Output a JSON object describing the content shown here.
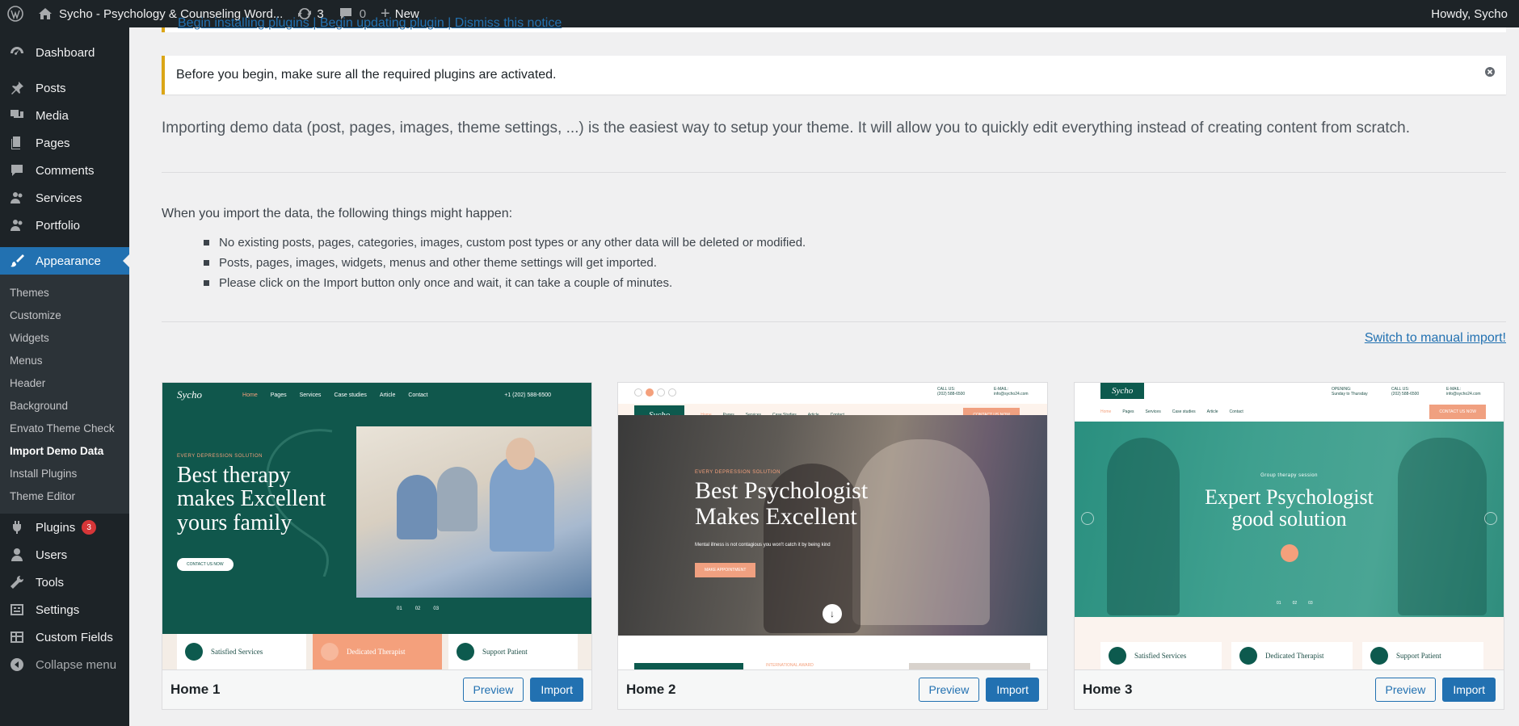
{
  "admin_bar": {
    "site_name": "Sycho - Psychology & Counseling Word...",
    "updates_count": "3",
    "comments_count": "0",
    "new_label": "New",
    "greeting": "Howdy, Sycho"
  },
  "sidebar": {
    "items": [
      {
        "label": "Dashboard",
        "icon": "dashboard-icon"
      },
      {
        "label": "Posts",
        "icon": "pin-icon"
      },
      {
        "label": "Media",
        "icon": "media-icon"
      },
      {
        "label": "Pages",
        "icon": "pages-icon"
      },
      {
        "label": "Comments",
        "icon": "comment-icon"
      },
      {
        "label": "Services",
        "icon": "users-icon"
      },
      {
        "label": "Portfolio",
        "icon": "users-icon"
      },
      {
        "label": "Appearance",
        "icon": "brush-icon"
      }
    ],
    "appearance_submenu": [
      "Themes",
      "Customize",
      "Widgets",
      "Menus",
      "Header",
      "Background",
      "Envato Theme Check",
      "Import Demo Data",
      "Install Plugins",
      "Theme Editor"
    ],
    "lower_items": [
      {
        "label": "Plugins",
        "icon": "plugin-icon",
        "badge": "3"
      },
      {
        "label": "Users",
        "icon": "user-icon"
      },
      {
        "label": "Tools",
        "icon": "wrench-icon"
      },
      {
        "label": "Settings",
        "icon": "settings-icon"
      },
      {
        "label": "Custom Fields",
        "icon": "table-icon"
      }
    ],
    "collapse_label": "Collapse menu"
  },
  "notices": {
    "top_links": "Begin installing plugins | Begin updating plugin | Dismiss this notice",
    "plugin_notice": "Before you begin, make sure all the required plugins are activated."
  },
  "main": {
    "intro": "Importing demo data (post, pages, images, theme settings, ...) is the easiest way to setup your theme. It will allow you to quickly edit everything instead of creating content from scratch.",
    "might_happen": "When you import the data, the following things might happen:",
    "bullets": [
      "No existing posts, pages, categories, images, custom post types or any other data will be deleted or modified.",
      "Posts, pages, images, widgets, menus and other theme settings will get imported.",
      "Please click on the Import button only once and wait, it can take a couple of minutes."
    ],
    "switch_link": "Switch to manual import!"
  },
  "demos": [
    {
      "name": "Home 1",
      "preview_label": "Preview",
      "import_label": "Import",
      "shot": {
        "logo": "Sycho",
        "nav": [
          "Home",
          "Pages",
          "Services",
          "Case studies",
          "Article",
          "Contact"
        ],
        "phone": "+1 (202) 588-6500",
        "eyebrow": "EVERY DEPRESSION SOLUTION",
        "headline_lines": [
          "Best therapy",
          "makes Excellent",
          "yours family"
        ],
        "cta": "CONTACT US NOW",
        "slides": [
          "01",
          "02",
          "03"
        ],
        "services": [
          "Satisfied Services",
          "Dedicated Therapist",
          "Support Patient"
        ]
      }
    },
    {
      "name": "Home 2",
      "preview_label": "Preview",
      "import_label": "Import",
      "shot": {
        "logo": "Sycho",
        "nav": [
          "Home",
          "Pages",
          "Services",
          "Case Studies",
          "Article",
          "Contact"
        ],
        "call": "CALL US:",
        "call_num": "(202) 588-6500",
        "mail": "E-MAIL:",
        "mail_addr": "info@sycho24.com",
        "cta_top": "CONTACT US NOW",
        "eyebrow": "EVERY DEPRESSION SOLUTION",
        "headline_lines": [
          "Best Psychologist",
          "Makes Excellent"
        ],
        "sub": "Mental illness is not contagious you won't catch it by being kind",
        "cta": "MAKE APPOINTMENT",
        "footer_tag": "INTERNATIONAL AWARD"
      }
    },
    {
      "name": "Home 3",
      "preview_label": "Preview",
      "import_label": "Import",
      "shot": {
        "logo": "Sycho",
        "nav": [
          "Home",
          "Pages",
          "Services",
          "Case studies",
          "Article",
          "Contact"
        ],
        "open": "OPENING:",
        "open_val": "Sunday to Thursday",
        "call": "CALL US:",
        "call_num": "(202) 588-6500",
        "mail": "E-MAIL:",
        "mail_addr": "info@sycho24.com",
        "cta_top": "CONTACT US NOW",
        "eyebrow": "Group therapy session",
        "headline_lines": [
          "Expert Psychologist",
          "good solution"
        ],
        "slides": [
          "01",
          "02",
          "03"
        ],
        "services": [
          "Satisfied Services",
          "Dedicated Therapist",
          "Support Patient"
        ]
      }
    }
  ],
  "colors": {
    "wp_dark": "#1d2327",
    "wp_blue": "#2271b1",
    "notice_yellow": "#dba617",
    "sycho_green": "#0d5a4e",
    "sycho_peach": "#f4a07c"
  }
}
